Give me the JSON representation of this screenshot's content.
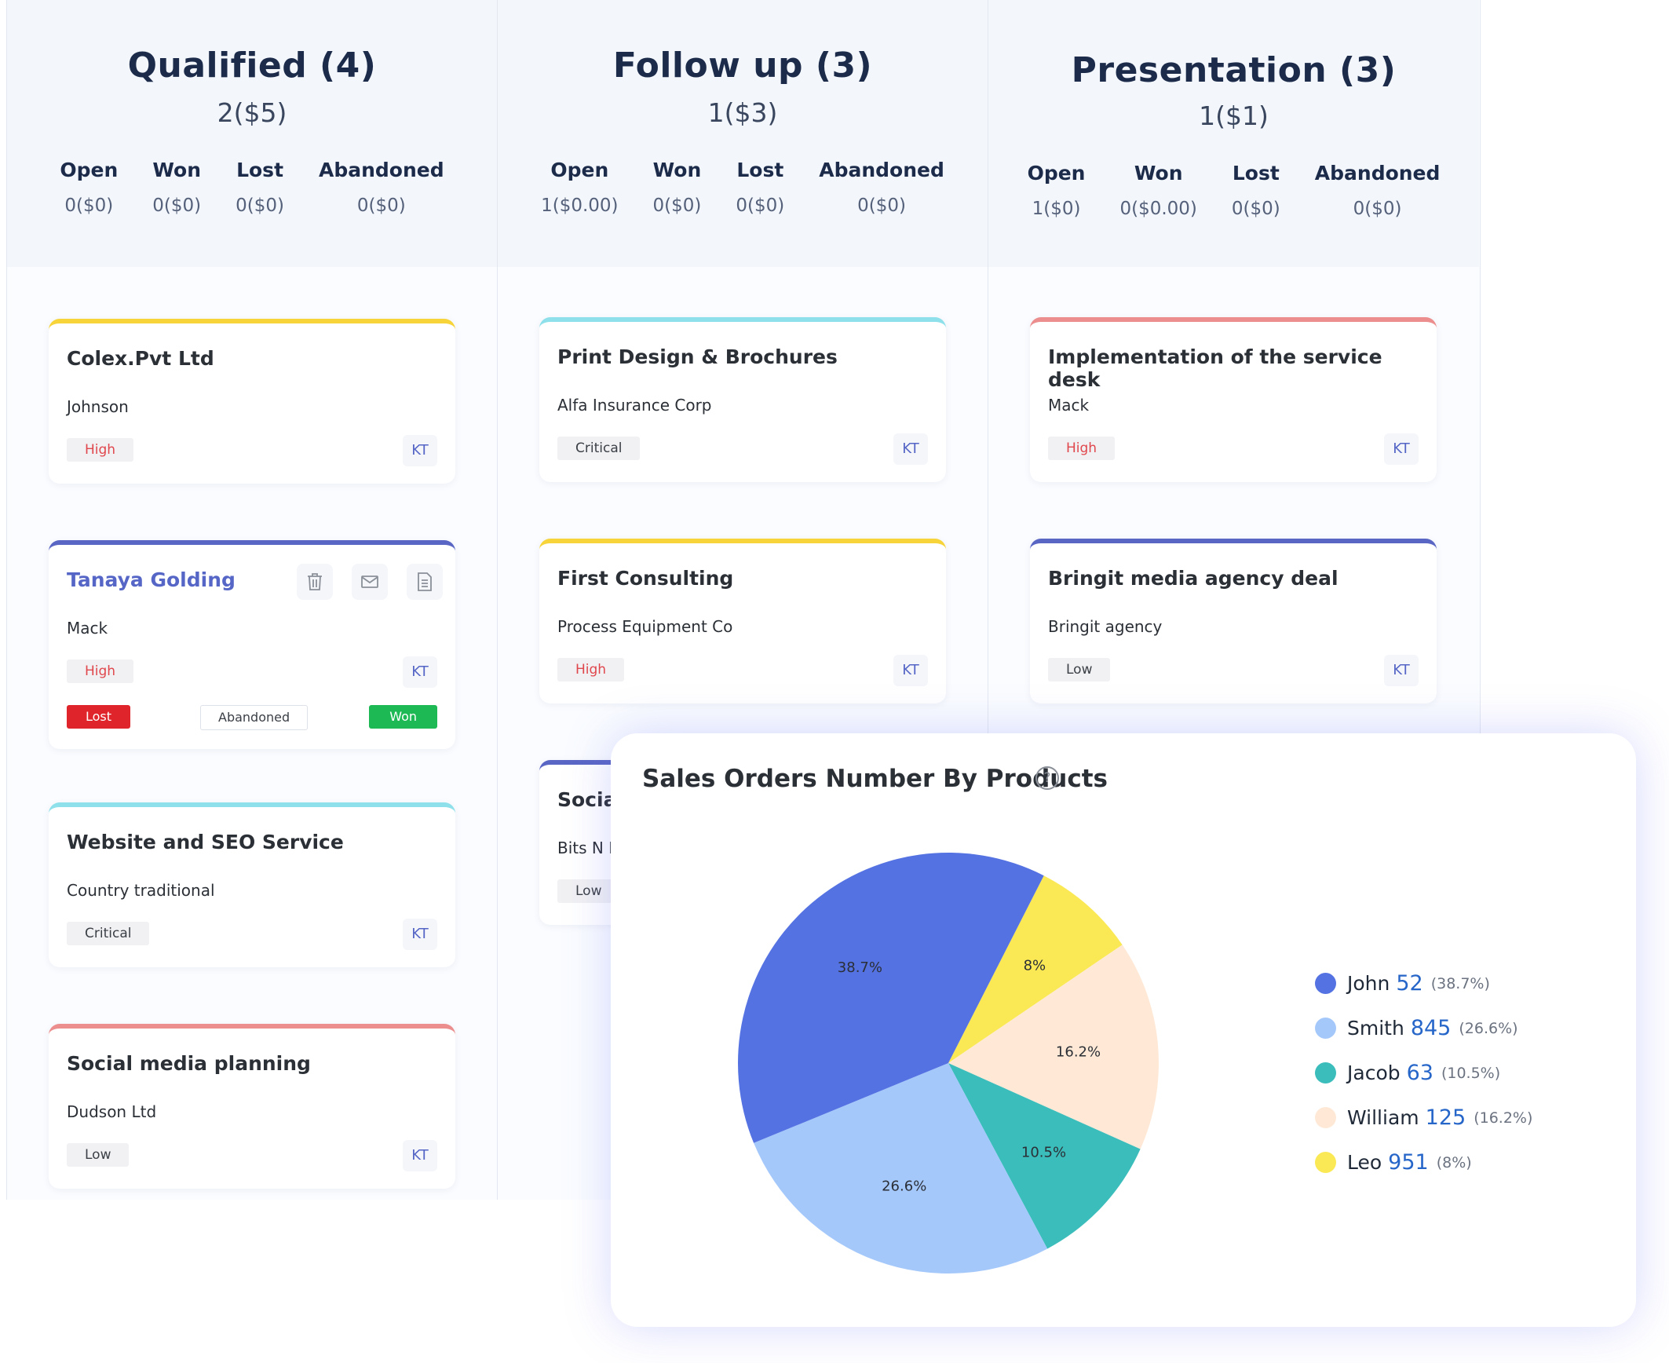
{
  "columns": [
    {
      "title": "Qualified (4)",
      "total": "2($5)",
      "stats": [
        {
          "label": "Open",
          "value": "0($0)"
        },
        {
          "label": "Won",
          "value": "0($0)"
        },
        {
          "label": "Lost",
          "value": "0($0)"
        },
        {
          "label": "Abandoned",
          "value": "0($0)"
        }
      ],
      "cards": [
        {
          "title": "Colex.Pvt Ltd",
          "contact": "Johnson",
          "priority": "High",
          "owner": "KT"
        },
        {
          "title": "Tanaya Golding",
          "contact": "Mack",
          "priority": "High",
          "owner": "KT",
          "actions": {
            "lost": "Lost",
            "abandoned": "Abandoned",
            "won": "Won"
          }
        },
        {
          "title": "Website and SEO Service",
          "contact": "Country traditional",
          "priority": "Critical",
          "owner": "KT"
        },
        {
          "title": "Social media planning",
          "contact": "Dudson Ltd",
          "priority": "Low",
          "owner": "KT"
        }
      ]
    },
    {
      "title": "Follow up (3)",
      "total": "1($3)",
      "stats": [
        {
          "label": "Open",
          "value": "1($0.00)"
        },
        {
          "label": "Won",
          "value": "0($0)"
        },
        {
          "label": "Lost",
          "value": "0($0)"
        },
        {
          "label": "Abandoned",
          "value": "0($0)"
        }
      ],
      "cards": [
        {
          "title": "Print Design & Brochures",
          "contact": "Alfa Insurance Corp",
          "priority": "Critical",
          "owner": "KT"
        },
        {
          "title": "First Consulting",
          "contact": "Process Equipment Co",
          "priority": "High",
          "owner": "KT"
        },
        {
          "title": "Socia",
          "contact": "Bits N P",
          "priority": "Low"
        }
      ]
    },
    {
      "title": "Presentation (3)",
      "total": "1($1)",
      "stats": [
        {
          "label": "Open",
          "value": "1($0)"
        },
        {
          "label": "Won",
          "value": "0($0.00)"
        },
        {
          "label": "Lost",
          "value": "0($0)"
        },
        {
          "label": "Abandoned",
          "value": "0($0)"
        }
      ],
      "cards": [
        {
          "title": "Implementation of the service desk",
          "contact": "Mack",
          "priority": "High",
          "owner": "KT"
        },
        {
          "title": "Bringit media agency deal",
          "contact": "Bringit agency",
          "priority": "Low",
          "owner": "KT"
        }
      ]
    }
  ],
  "chart_data": {
    "type": "pie",
    "title": "Sales Orders Number By Products",
    "slices": [
      {
        "name": "John",
        "value": 52,
        "percent": 38.7,
        "label": "38.7%",
        "legend_pct": "(38.7%)",
        "color": "#5472e2"
      },
      {
        "name": "Smith",
        "value": 845,
        "percent": 26.6,
        "label": "26.6%",
        "legend_pct": "(26.6%)",
        "color": "#a5c8fb"
      },
      {
        "name": "Jacob",
        "value": 63,
        "percent": 10.5,
        "label": "10.5%",
        "legend_pct": "(10.5%)",
        "color": "#3bbdbb"
      },
      {
        "name": "William",
        "value": 125,
        "percent": 16.2,
        "label": "16.2%",
        "legend_pct": "(16.2%)",
        "color": "#ffe9d6"
      },
      {
        "name": "Leo",
        "value": 951,
        "percent": 8,
        "label": "8%",
        "legend_pct": "(8%)",
        "color": "#fae955"
      }
    ],
    "legend_position": "right"
  },
  "colors": {
    "accent_yellow": "#f7d53a",
    "accent_cyan": "#8ee0ea",
    "accent_red": "#ec8e8e",
    "accent_indigo": "#5a66c4",
    "priority_high": "#e0474d",
    "won": "#1db954",
    "lost": "#e0242b"
  }
}
